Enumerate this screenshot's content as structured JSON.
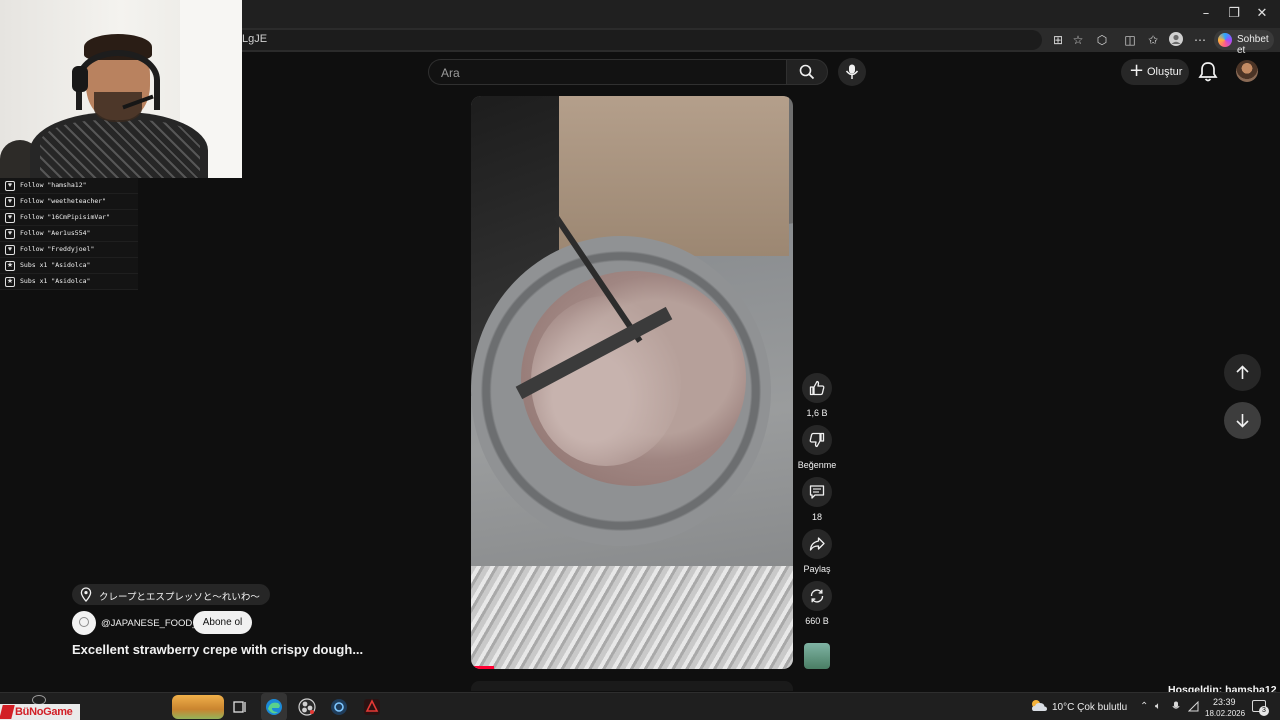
{
  "browser": {
    "url_fragment": "LgJE",
    "copilot_label": "Sohbet et",
    "window_controls": {
      "minimize": "–",
      "maximize": "❐",
      "close": "✕"
    }
  },
  "stream_overlay": {
    "alerts": [
      {
        "icon": "heart-icon",
        "text": "Follow \"hamsha12\""
      },
      {
        "icon": "heart-icon",
        "text": "Follow \"weetheteacher\""
      },
      {
        "icon": "heart-icon",
        "text": "Follow \"16CmPipisimVar\""
      },
      {
        "icon": "heart-icon",
        "text": "Follow \"Aer1us554\""
      },
      {
        "icon": "heart-icon",
        "text": "Follow \"Freddyjoel\""
      },
      {
        "icon": "star-icon",
        "text": "Subs x1 \"Asidolca\""
      },
      {
        "icon": "star-icon",
        "text": "Subs x1 \"Asidolca\""
      }
    ],
    "welcome": "Hoşgeldin: hamsha12",
    "brand": "BüNoGame"
  },
  "header": {
    "search_placeholder": "Ara",
    "create_label": "Oluştur"
  },
  "short": {
    "location": "クレープとエスプレッソと〜れいわ〜",
    "channel": "@JAPANESE_FOOD_",
    "subscribe_label": "Abone ol",
    "title": "Excellent strawberry crepe with crispy dough...",
    "progress": 0.07
  },
  "actions": {
    "likes": "1,6 B",
    "dislike_label": "Beğenme",
    "comments": "18",
    "share_label": "Paylaş",
    "remix": "660 B"
  },
  "taskbar": {
    "weather": "10°C  Çok bulutlu",
    "time": "23:39",
    "date": "18.02.2026",
    "notifications": "3"
  }
}
